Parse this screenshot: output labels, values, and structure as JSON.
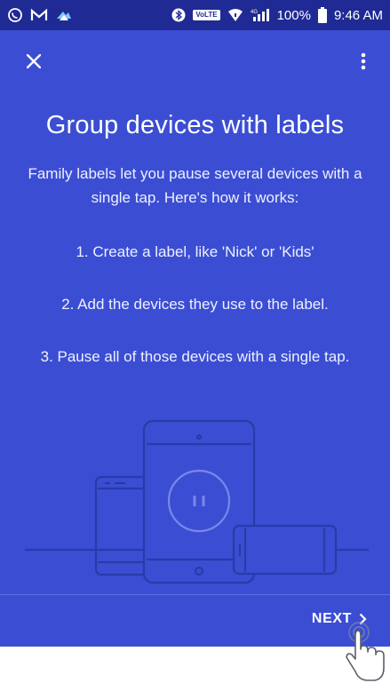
{
  "status_bar": {
    "left_icons": [
      "whatsapp-icon",
      "gmail-icon",
      "app-icon"
    ],
    "right_icons": [
      "bluetooth-icon",
      "volte-icon",
      "wifi-icon",
      "signal-icon",
      "battery-icon"
    ],
    "volte_label": "VoLTE",
    "signal_tag": "4G",
    "battery": "100%",
    "time": "9:46 AM"
  },
  "toolbar": {
    "close_icon": "close-icon",
    "menu_icon": "more-vert-icon"
  },
  "content": {
    "title": "Group devices with labels",
    "intro": "Family labels let you pause several devices with a single tap. Here's how it works:",
    "steps": [
      "1. Create a label, like 'Nick' or 'Kids'",
      "2. Add the devices they use to the label.",
      "3. Pause all of those devices with a single tap."
    ]
  },
  "footer": {
    "next_label": "NEXT"
  },
  "colors": {
    "background": "#3b4ed3",
    "status_bar": "#1f2a94",
    "illustration_lines": "#2a3aa8",
    "text": "#ffffff"
  }
}
